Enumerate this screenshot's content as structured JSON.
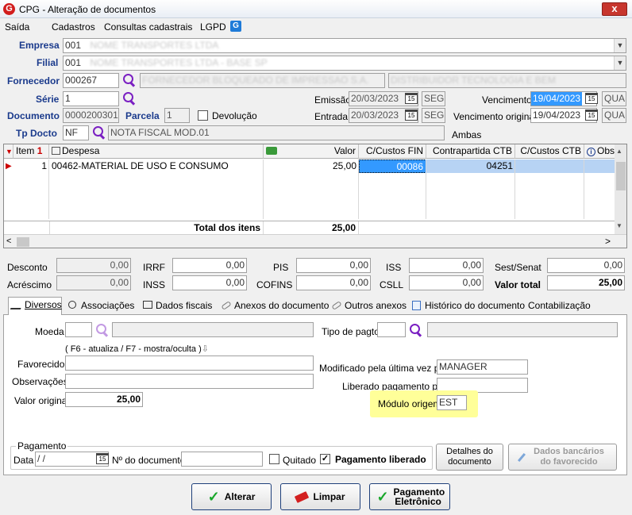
{
  "window": {
    "title": "CPG - Alteração de documentos",
    "close": "x"
  },
  "menu": [
    "Saída",
    "Cadastros",
    "Consultas cadastrais",
    "LGPD"
  ],
  "form": {
    "empresa_label": "Empresa",
    "empresa_code": "001",
    "empresa_name": "NOME TRANSPORTES LTDA",
    "filial_label": "Filial",
    "filial_code": "001",
    "filial_name": "NOME TRANSPORTES LTDA - BASE SP",
    "fornecedor_label": "Fornecedor",
    "fornecedor_code": "000267",
    "fornecedor_name": "FORNECEDOR BLOQUEADO DE IMPRESSAO S.A.",
    "fornecedor_extra": "DISTRIBUIDOR TECNOLOGIA E BEM",
    "serie_label": "Série",
    "serie_value": "1",
    "documento_label": "Documento",
    "documento_value": "0000200301",
    "parcela_label": "Parcela",
    "parcela_value": "1",
    "devolucao_label": "Devolução",
    "tpdocto_label": "Tp Docto",
    "tpdocto_code": "NF",
    "tpdocto_name": "NOTA FISCAL MOD.01",
    "emissao_label": "Emissão",
    "emissao_value": "20/03/2023",
    "emissao_day": "SEG",
    "entrada_label": "Entrada",
    "entrada_value": "20/03/2023",
    "entrada_day": "SEG",
    "vencimento_label": "Vencimento",
    "vencimento_value": "19/04/2023",
    "vencimento_day": "QUA",
    "venc_orig_label": "Vencimento original",
    "venc_orig_value": "19/04/2023",
    "venc_orig_day": "QUA",
    "ambas": "Ambas",
    "cal_glyph": "15"
  },
  "grid": {
    "headers": {
      "item": "Item",
      "item_num": "1",
      "despesa": "Despesa",
      "valor": "Valor",
      "ccfin": "C/Custos FIN",
      "contra": "Contrapartida CTB",
      "ccctb": "C/Custos CTB",
      "obs": "Obs"
    },
    "row": {
      "item": "1",
      "despesa": "00462-MATERIAL DE USO E CONSUMO",
      "valor": "25,00",
      "ccfin": "00086",
      "contra": "04251"
    },
    "total_label": "Total dos itens",
    "total_value": "25,00"
  },
  "totals": {
    "desconto_label": "Desconto",
    "desconto": "0,00",
    "acrescimo_label": "Acréscimo",
    "acrescimo": "0,00",
    "irrf_label": "IRRF",
    "irrf": "0,00",
    "inss_label": "INSS",
    "inss": "0,00",
    "pis_label": "PIS",
    "pis": "0,00",
    "cofins_label": "COFINS",
    "cofins": "0,00",
    "iss_label": "ISS",
    "iss": "0,00",
    "csll_label": "CSLL",
    "csll": "0,00",
    "sest_label": "Sest/Senat",
    "sest": "0,00",
    "valortotal_label": "Valor total",
    "valortotal": "25,00"
  },
  "tabs": [
    "Diversos",
    "Associações",
    "Dados fiscais",
    "Anexos do documento",
    "Outros anexos",
    "Histórico do documento",
    "Contabilização"
  ],
  "diversos": {
    "moeda_label": "Moeda",
    "tipo_pagto_label": "Tipo de pagto",
    "hint": "( F6 - atualiza / F7 - mostra/oculta )",
    "favorecido_label": "Favorecido",
    "observacoes_label": "Observações",
    "valor_original_label": "Valor original",
    "valor_original": "25,00",
    "modificado_label": "Modificado pela última vez por",
    "modificado_value": "MANAGER",
    "liberado_label": "Liberado pagamento por",
    "liberado_value": "",
    "modulo_label": "Módulo origem",
    "modulo_value": "EST",
    "pagamento_group": "Pagamento",
    "data_label": "Data",
    "data_value": " /  /",
    "ndoc_label": "Nº do documento",
    "quitado_label": "Quitado",
    "pag_liberado_label": "Pagamento liberado",
    "detalhes_btn": "Detalhes do documento",
    "dados_bancarios_btn": "Dados bancários do favorecido"
  },
  "buttons": {
    "alterar": "Alterar",
    "limpar": "Limpar",
    "pagamento": "Pagamento Eletrônico"
  },
  "colors": {
    "accent": "#1a3a8c",
    "selection": "#3399ff",
    "highlight": "#ffff99"
  }
}
